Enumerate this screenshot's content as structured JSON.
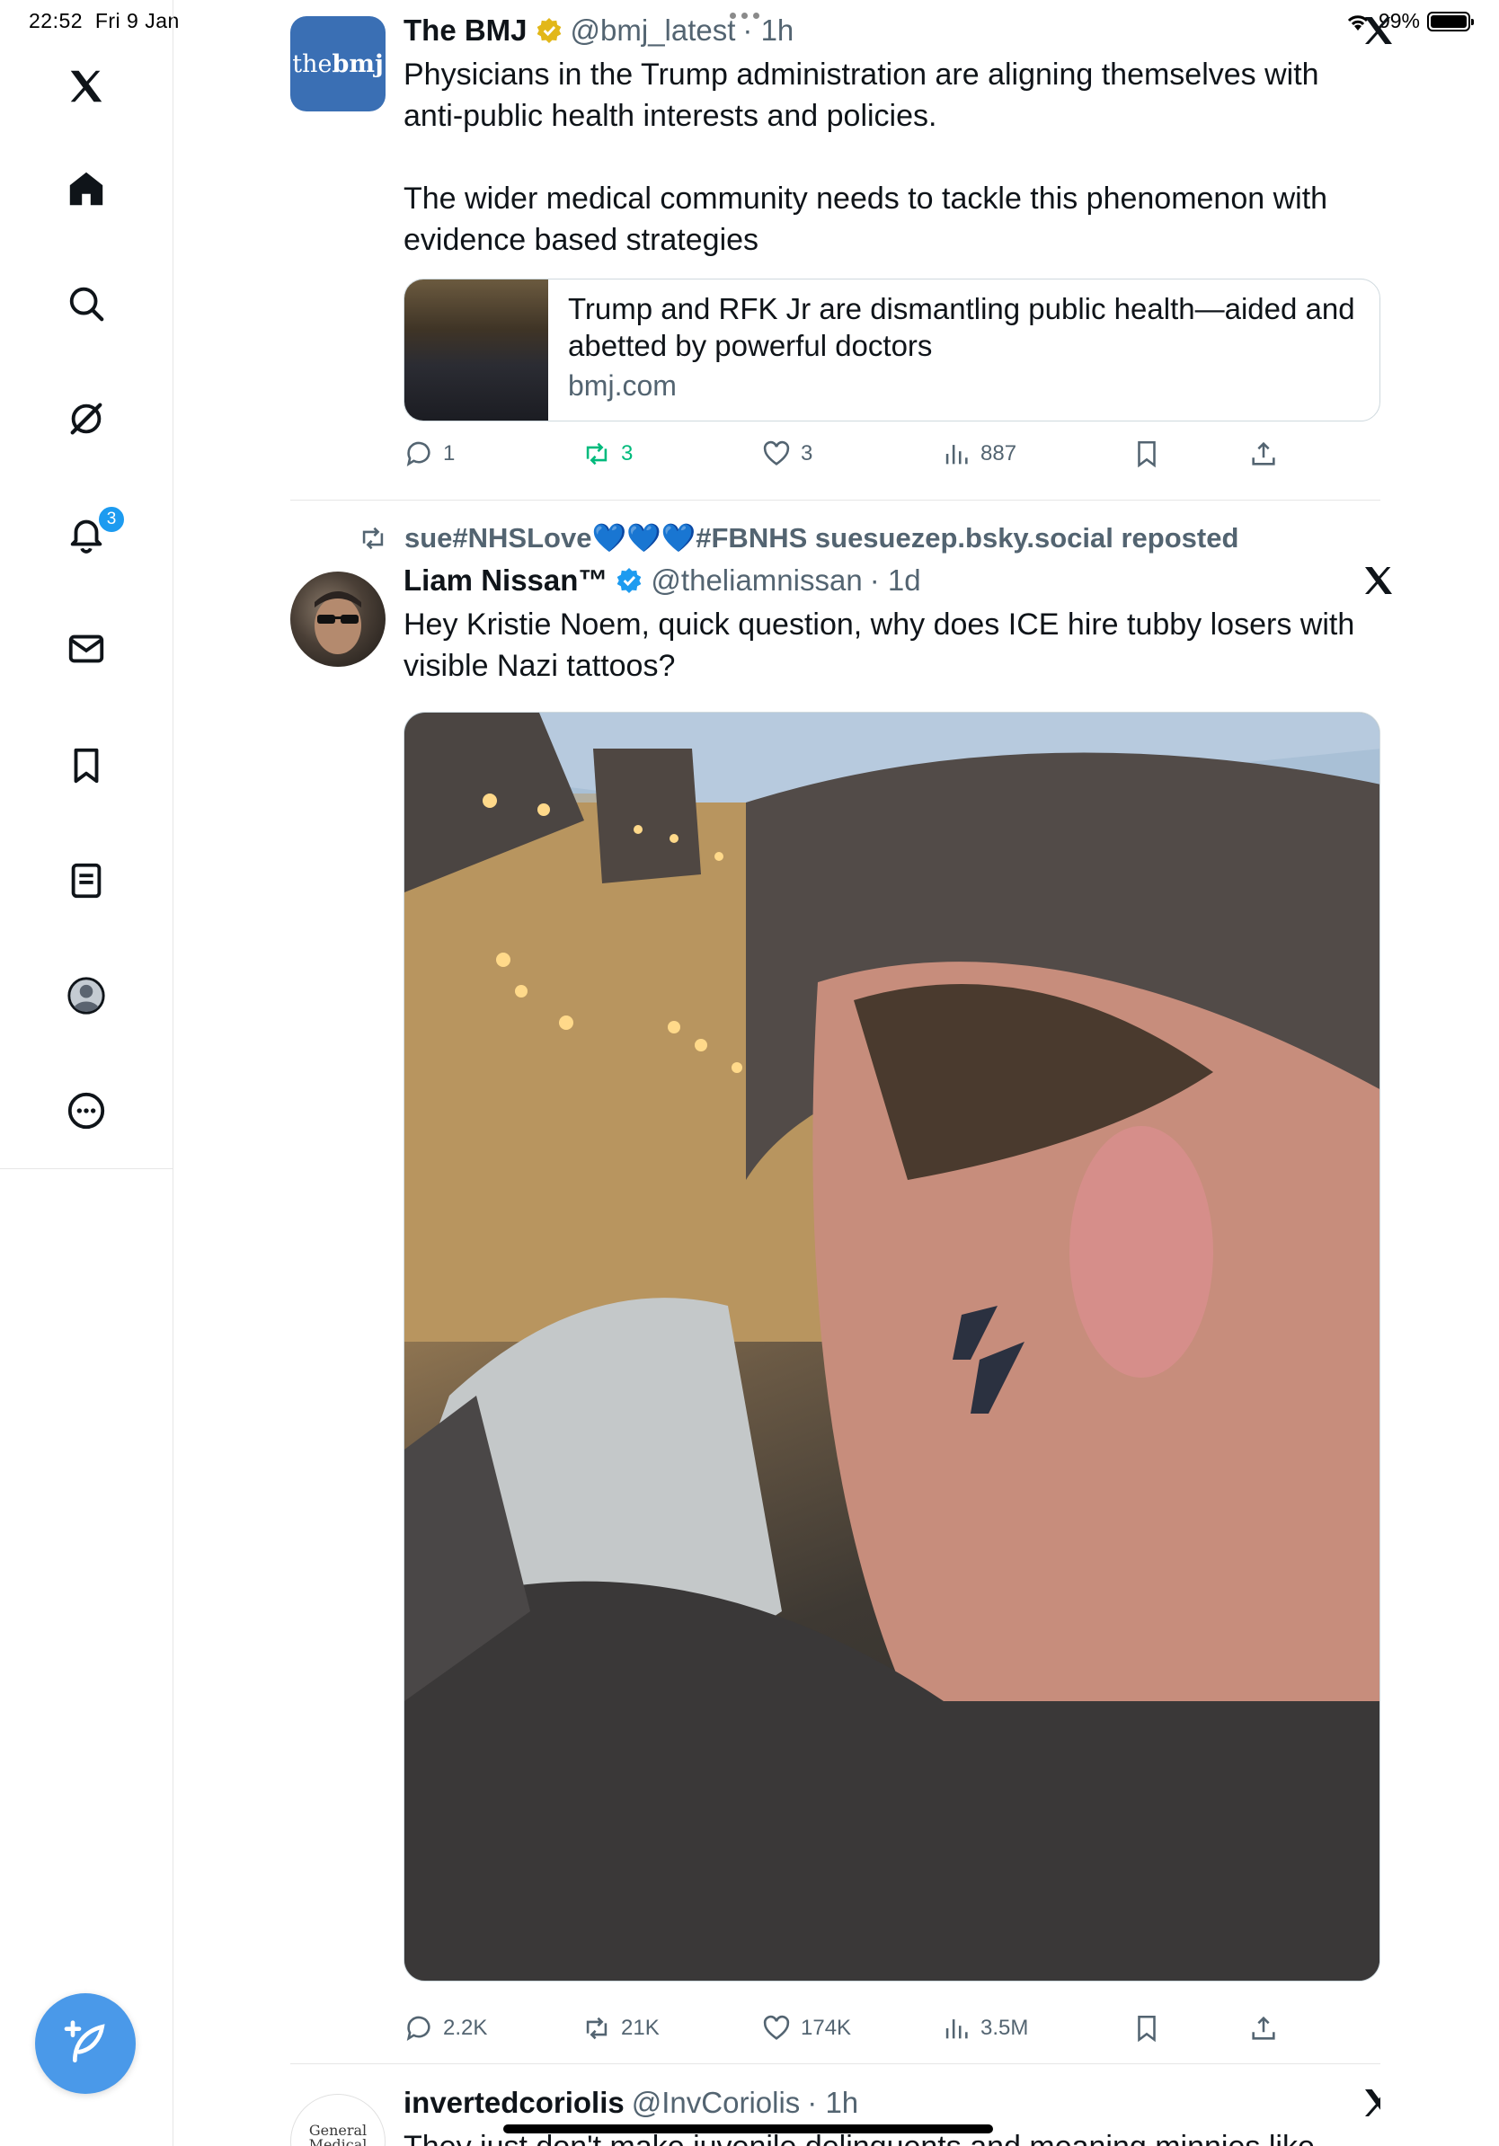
{
  "status": {
    "time": "22:52",
    "date": "Fri 9 Jan",
    "battery": "99%",
    "battery_level": 0.99
  },
  "sidebar": {
    "items": [
      {
        "name": "x-logo",
        "icon": "x-logo-icon"
      },
      {
        "name": "home",
        "icon": "home-icon"
      },
      {
        "name": "explore",
        "icon": "search-icon"
      },
      {
        "name": "grok",
        "icon": "grok-icon"
      },
      {
        "name": "notifications",
        "icon": "bell-icon",
        "badge": "3"
      },
      {
        "name": "messages",
        "icon": "mail-icon"
      },
      {
        "name": "bookmarks",
        "icon": "bookmark-icon"
      },
      {
        "name": "lists",
        "icon": "list-icon"
      },
      {
        "name": "profile",
        "icon": "profile-icon"
      },
      {
        "name": "more",
        "icon": "more-icon"
      }
    ],
    "compose_icon": "compose-icon"
  },
  "tweets": [
    {
      "author": "The BMJ",
      "handle": "@bmj_latest",
      "time": "· 1h",
      "avatar_text": "thebmj",
      "text": "Physicians in the Trump administration are aligning themselves with anti-public health interests and policies.\n\nThe wider medical community needs to tackle this phenomenon with evidence based strategies",
      "card": {
        "title": "Trump and RFK Jr are dismantling public health—aided and abetted by powerful doctors",
        "domain": "bmj.com"
      },
      "replies": "1",
      "reposts": "3",
      "likes": "3",
      "views": "887"
    },
    {
      "repost_by": "sue#NHSLove💙💙💙#FBNHS suesuezep.bsky.social reposted",
      "author": "Liam Nissan™",
      "handle": "@theliamnissan",
      "time": "· 1d",
      "text": "Hey Kristie Noem, quick question, why does ICE hire tubby losers with visible Nazi tattoos?",
      "replies": "2.2K",
      "reposts": "21K",
      "likes": "174K",
      "views": "3.5M"
    },
    {
      "author": "invertedcoriolis",
      "handle": "@InvCoriolis",
      "time": "· 1h",
      "avatar_text": "General Medical Council",
      "text": "They just don't make juvenile delinquents and meaning minnies like"
    }
  ],
  "colors": {
    "accent": "#1d9bf0",
    "repost_green": "#00ba7c",
    "secondary_text": "#536471",
    "verified_gold": "#e2b719"
  }
}
